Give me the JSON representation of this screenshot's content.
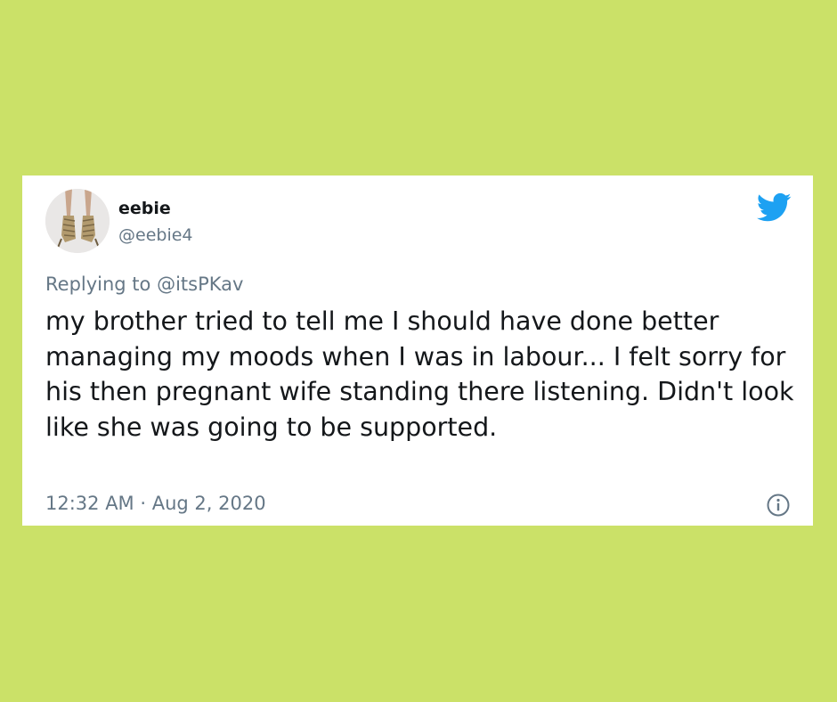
{
  "tweet": {
    "display_name": "eebie",
    "handle": "@eebie4",
    "replying_to": "Replying to @itsPKav",
    "text": "my brother tried to tell me I should have done better managing my moods when I was in labour... I felt sorry for his then pregnant wife standing there listening. Didn't look like she was going to be supported.",
    "time": "12:32 AM",
    "separator": " · ",
    "date": "Aug 2, 2020"
  },
  "icons": {
    "brand": "twitter-bird-icon",
    "info": "info-icon"
  },
  "colors": {
    "background": "#cbe168",
    "card": "#ffffff",
    "text_primary": "#14171a",
    "text_secondary": "#657786",
    "twitter_blue": "#1da1f2"
  }
}
